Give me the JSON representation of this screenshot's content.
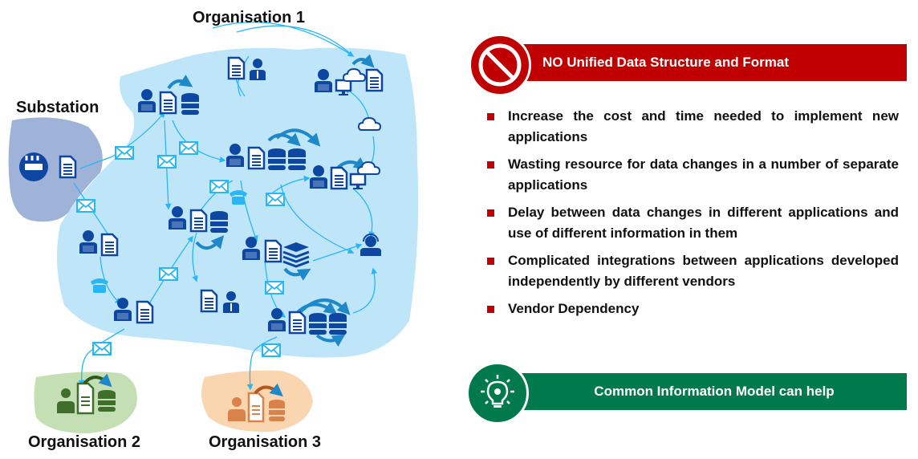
{
  "diagram": {
    "labels": {
      "organisation_1": "Organisation 1",
      "substation": "Substation",
      "organisation_2": "Organisation 2",
      "organisation_3": "Organisation 3"
    },
    "colors": {
      "org1_region": "#bfe6f8",
      "substation_region": "#9fb3d9",
      "org2_region": "#c5dfb5",
      "org3_region": "#f9d5b0",
      "icon_primary": "#0d47a1",
      "icon_light": "#29b6f6",
      "org2_icon": "#3f6f2a",
      "org3_icon": "#d9824a"
    }
  },
  "problem": {
    "banner_icon": "prohibited-icon",
    "title": "NO Unified Data Structure and Format",
    "accent": "#c00000",
    "issues": [
      "Increase the cost and time needed to implement new applications",
      "Wasting resource for data changes in a number of separate applications",
      "Delay between data changes in different applications and use of different information in them",
      "Complicated integrations between applications developed independently by different vendors",
      "Vendor Dependency"
    ]
  },
  "solution": {
    "banner_icon": "lightbulb-gear-icon",
    "title": "Common Information Model can help",
    "accent": "#007a4d"
  }
}
